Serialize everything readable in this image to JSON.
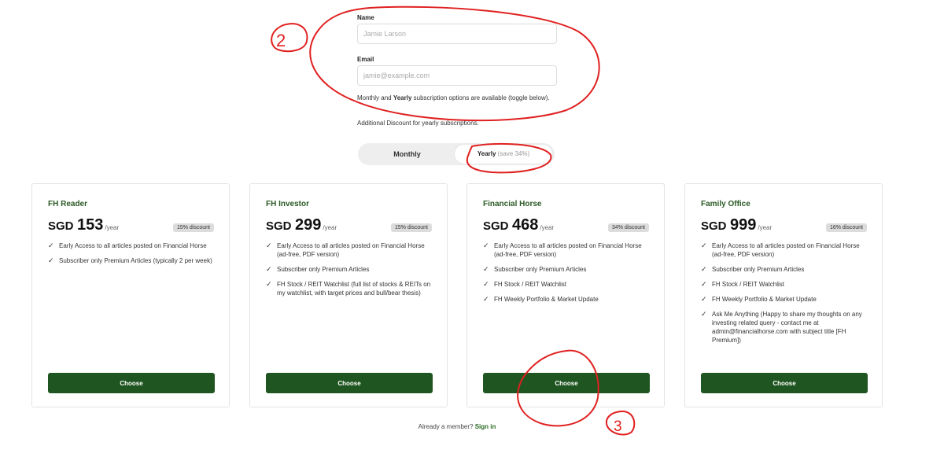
{
  "form": {
    "name_label": "Name",
    "name_placeholder": "Jamie Larson",
    "email_label": "Email",
    "email_placeholder": "jamie@example.com",
    "note_prefix": "Monthly",
    "note_and": " and ",
    "note_yearly": "Yearly",
    "note_suffix": " subscription options are available (toggle below).",
    "discount_note": "Additional Discount for yearly subscriptions."
  },
  "toggle": {
    "monthly_label": "Monthly",
    "yearly_label": "Yearly",
    "yearly_save": "(save 34%)",
    "selected": "Yearly"
  },
  "plans": [
    {
      "name": "FH Reader",
      "currency": "SGD",
      "price": "153",
      "period": "/year",
      "discount": "15% discount",
      "features": [
        "Early Access to all articles posted on Financial Horse",
        "Subscriber only Premium Articles (typically 2 per week)"
      ],
      "button": "Choose"
    },
    {
      "name": "FH Investor",
      "currency": "SGD",
      "price": "299",
      "period": "/year",
      "discount": "15% discount",
      "features": [
        "Early Access to all articles posted on Financial Horse (ad-free, PDF version)",
        "Subscriber only Premium Articles",
        "FH Stock / REIT Watchlist (full list of stocks & REITs on my watchlist, with target prices and bull/bear thesis)"
      ],
      "button": "Choose"
    },
    {
      "name": "Financial Horse",
      "currency": "SGD",
      "price": "468",
      "period": "/year",
      "discount": "34% discount",
      "features": [
        "Early Access to all articles posted on Financial Horse (ad-free, PDF version)",
        "Subscriber only Premium Articles",
        "FH Stock / REIT Watchlist",
        "FH Weekly Portfolio & Market Update"
      ],
      "button": "Choose"
    },
    {
      "name": "Family Office",
      "currency": "SGD",
      "price": "999",
      "period": "/year",
      "discount": "16% discount",
      "features": [
        "Early Access to all articles posted on Financial Horse (ad-free, PDF version)",
        "Subscriber only Premium Articles",
        "FH Stock / REIT Watchlist",
        "FH Weekly Portfolio & Market Update",
        "Ask Me Anything (Happy to share my thoughts on any investing related query - contact me at admin@financialhorse.com with subject title [FH Premium])"
      ],
      "button": "Choose"
    }
  ],
  "footer": {
    "already_member": "Already a member?",
    "sign_in": "Sign in"
  },
  "annotations": {
    "color": "#e02020",
    "labels": [
      "2",
      "3"
    ]
  },
  "colors": {
    "brand_green": "#1f5520",
    "plan_title_green": "#2a5a24",
    "discount_badge": "#dcdcdc"
  },
  "icons": {
    "feature": "check-icon"
  }
}
